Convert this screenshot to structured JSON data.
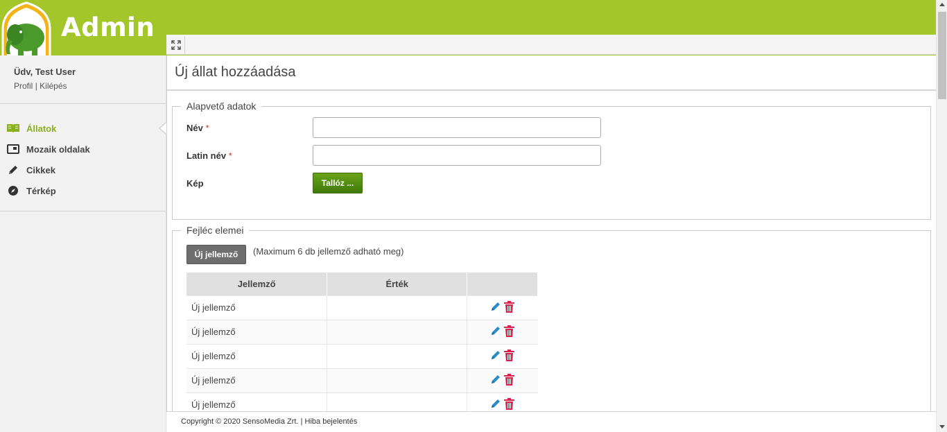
{
  "header": {
    "brand": "Admin",
    "accent_color": "#a3c72b"
  },
  "toolbar": {
    "expand_icon": "expand-icon"
  },
  "sidebar": {
    "greeting": "Üdv, Test User",
    "profile_link": "Profil",
    "separator": "|",
    "logout_link": "Kilépés",
    "items": [
      {
        "label": "Állatok",
        "icon": "book-icon",
        "active": true
      },
      {
        "label": "Mozaik oldalak",
        "icon": "window-icon",
        "active": false
      },
      {
        "label": "Cikkek",
        "icon": "pencil-icon",
        "active": false
      },
      {
        "label": "Térkép",
        "icon": "compass-icon",
        "active": false
      }
    ]
  },
  "page": {
    "title": "Új állat hozzáadása"
  },
  "basic": {
    "legend": "Alapvető adatok",
    "name_label": "Név",
    "latin_label": "Latin név",
    "required_mark": "*",
    "name_value": "",
    "latin_value": "",
    "image_label": "Kép",
    "browse_button": "Tallóz ..."
  },
  "header_items": {
    "legend": "Fejléc elemei",
    "new_button": "Új jellemző",
    "hint": "(Maximum 6 db jellemző adható meg)",
    "columns": [
      "Jellemző",
      "Érték",
      ""
    ],
    "rows": [
      {
        "feature": "Új jellemző",
        "value": ""
      },
      {
        "feature": "Új jellemző",
        "value": ""
      },
      {
        "feature": "Új jellemző",
        "value": ""
      },
      {
        "feature": "Új jellemző",
        "value": ""
      },
      {
        "feature": "Új jellemző",
        "value": ""
      }
    ],
    "edit_color": "#2a8cc4",
    "delete_color": "#d9214b"
  },
  "footer": {
    "copyright": "Copyright © 2020 SensoMedia Zrt.",
    "separator": "|",
    "report_link": "Hiba bejelentés"
  }
}
